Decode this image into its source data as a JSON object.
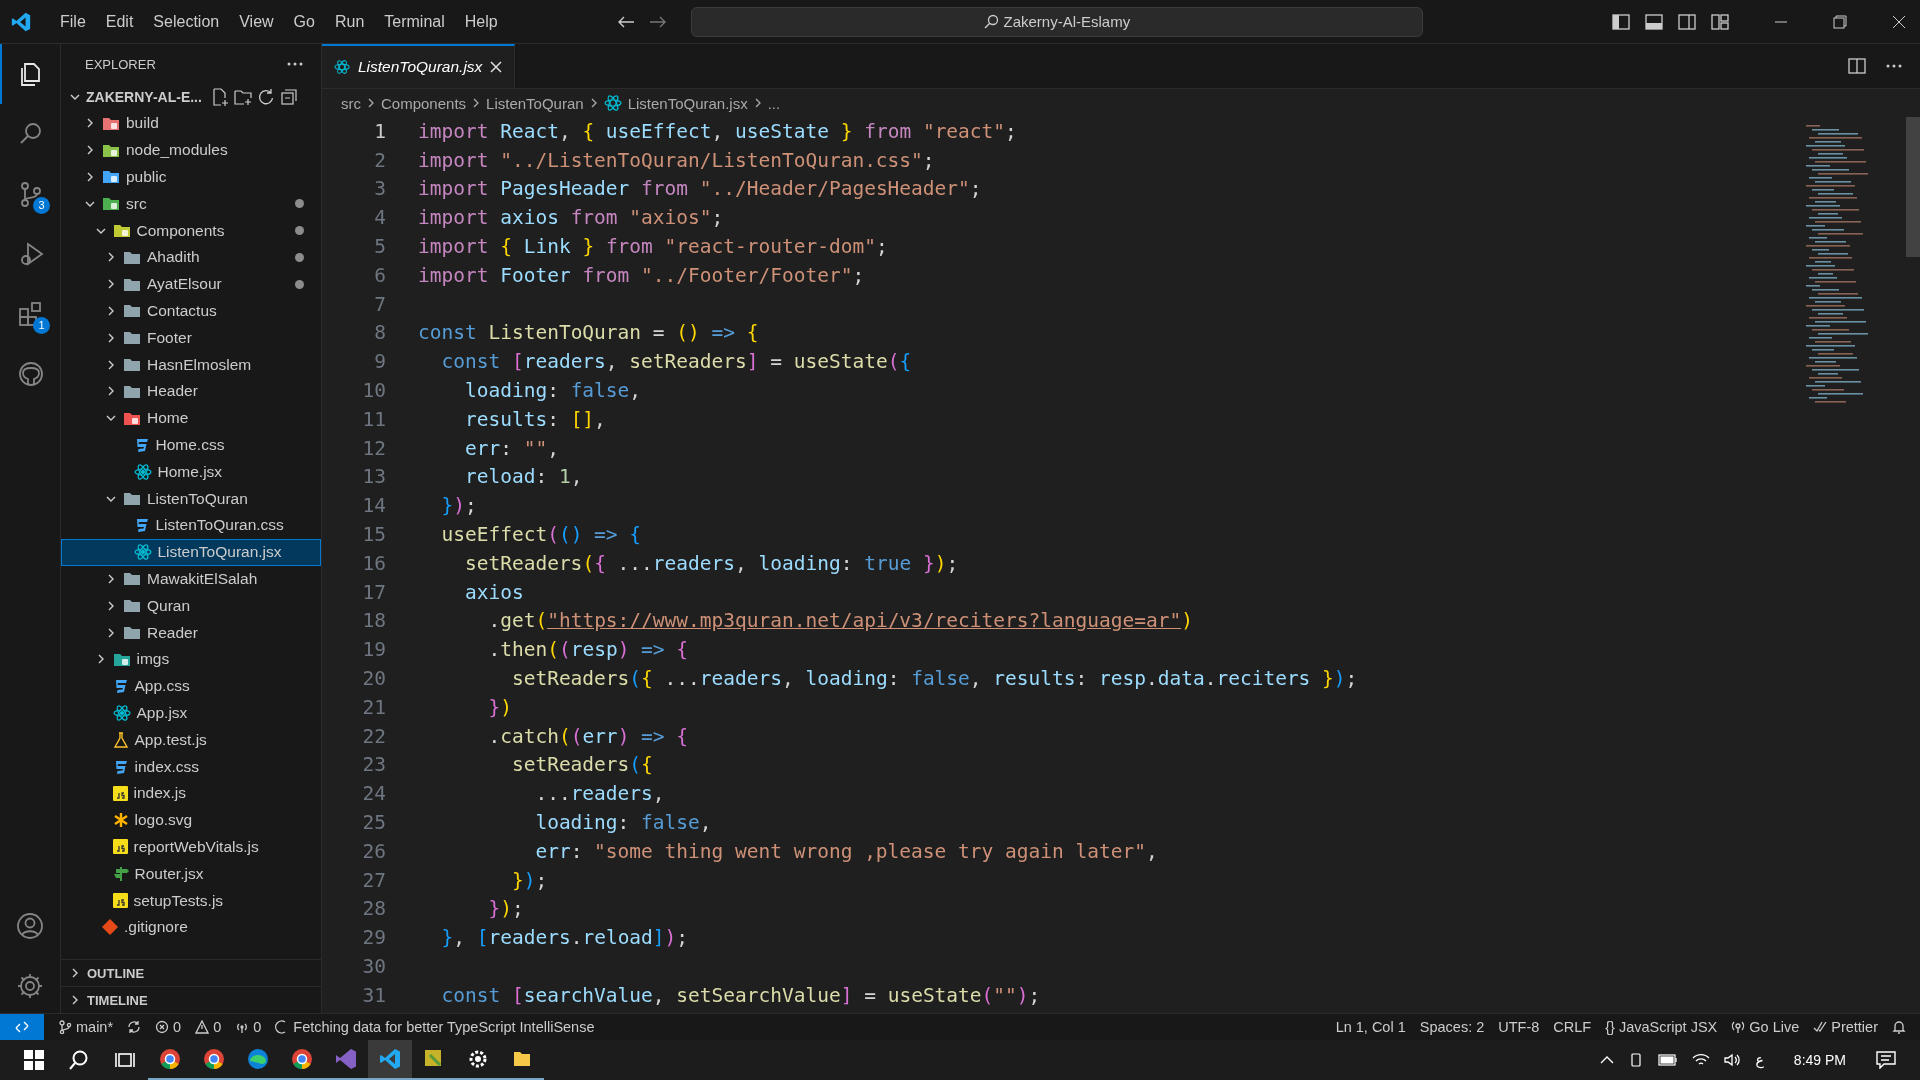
{
  "title_bar": {
    "menu": [
      "File",
      "Edit",
      "Selection",
      "View",
      "Go",
      "Run",
      "Terminal",
      "Help"
    ],
    "search": {
      "value": "Zakerny-Al-Eslamy"
    }
  },
  "activity_bar": {
    "items": [
      {
        "kind": "files",
        "selected": true
      },
      {
        "kind": "search",
        "selected": false
      },
      {
        "kind": "branch",
        "selected": false,
        "badge": "3"
      },
      {
        "kind": "debug",
        "selected": false
      },
      {
        "kind": "extensions",
        "selected": false,
        "badge": "1"
      },
      {
        "kind": "github",
        "selected": false
      }
    ]
  },
  "explorer": {
    "title": "EXPLORER",
    "root": "ZAKERNY-AL-E...",
    "tree": [
      {
        "name": "build",
        "kind": "build",
        "expanded": false,
        "selected": false,
        "modified": false
      },
      {
        "name": "node_modules",
        "kind": "node",
        "expanded": false,
        "selected": false,
        "modified": false
      },
      {
        "name": "public",
        "kind": "public",
        "expanded": false,
        "selected": false,
        "modified": false
      },
      {
        "name": "src",
        "kind": "src",
        "expanded": true,
        "selected": false,
        "modified": true,
        "children": [
          {
            "name": "Components",
            "kind": "components",
            "expanded": true,
            "selected": false,
            "modified": true,
            "children": [
              {
                "name": "Ahadith",
                "kind": "folder",
                "expanded": false,
                "selected": false,
                "modified": true
              },
              {
                "name": "AyatElsour",
                "kind": "folder",
                "expanded": false,
                "selected": false,
                "modified": true
              },
              {
                "name": "Contactus",
                "kind": "folder",
                "expanded": false,
                "selected": false,
                "modified": false
              },
              {
                "name": "Footer",
                "kind": "folder",
                "expanded": false,
                "selected": false,
                "modified": false
              },
              {
                "name": "HasnElmoslem",
                "kind": "folder",
                "expanded": false,
                "selected": false,
                "modified": false
              },
              {
                "name": "Header",
                "kind": "folder",
                "expanded": false,
                "selected": false,
                "modified": false
              },
              {
                "name": "Home",
                "kind": "home",
                "expanded": true,
                "selected": false,
                "modified": false,
                "children": [
                  {
                    "name": "Home.css",
                    "kind": "css",
                    "selected": false,
                    "modified": false
                  },
                  {
                    "name": "Home.jsx",
                    "kind": "react",
                    "selected": false,
                    "modified": false
                  }
                ]
              },
              {
                "name": "ListenToQuran",
                "kind": "folder",
                "expanded": true,
                "selected": false,
                "modified": false,
                "children": [
                  {
                    "name": "ListenToQuran.css",
                    "kind": "css",
                    "selected": false,
                    "modified": false
                  },
                  {
                    "name": "ListenToQuran.jsx",
                    "kind": "react",
                    "selected": true,
                    "modified": false
                  }
                ]
              },
              {
                "name": "MawakitElSalah",
                "kind": "folder",
                "expanded": false,
                "selected": false,
                "modified": false
              },
              {
                "name": "Quran",
                "kind": "folder",
                "expanded": false,
                "selected": false,
                "modified": false
              },
              {
                "name": "Reader",
                "kind": "folder",
                "expanded": false,
                "selected": false,
                "modified": false
              }
            ]
          },
          {
            "name": "imgs",
            "kind": "imgs",
            "expanded": false,
            "selected": false,
            "modified": false
          },
          {
            "name": "App.css",
            "kind": "css",
            "selected": false,
            "modified": false
          },
          {
            "name": "App.jsx",
            "kind": "react",
            "selected": false,
            "modified": false
          },
          {
            "name": "App.test.js",
            "kind": "test",
            "selected": false,
            "modified": false
          },
          {
            "name": "index.css",
            "kind": "css",
            "selected": false,
            "modified": false
          },
          {
            "name": "index.js",
            "kind": "js",
            "selected": false,
            "modified": false
          },
          {
            "name": "logo.svg",
            "kind": "logo",
            "selected": false,
            "modified": false
          },
          {
            "name": "reportWebVitals.js",
            "kind": "js",
            "selected": false,
            "modified": false
          },
          {
            "name": "Router.jsx",
            "kind": "router",
            "selected": false,
            "modified": false
          },
          {
            "name": "setupTests.js",
            "kind": "js",
            "selected": false,
            "modified": false
          }
        ]
      },
      {
        "name": ".gitignore",
        "kind": "git",
        "selected": false,
        "modified": false
      }
    ],
    "sections": [
      "OUTLINE",
      "TIMELINE"
    ]
  },
  "tabs": [
    {
      "label": "ListenToQuran.jsx",
      "selected": true
    }
  ],
  "breadcrumb": [
    "src",
    "Components",
    "ListenToQuran",
    "ListenToQuran.jsx",
    "..."
  ],
  "editor": {
    "lines": [
      {
        "number": "1",
        "tokens": [
          {
            "text": "import ",
            "kind": "ctl"
          },
          {
            "text": "React",
            "kind": "var"
          },
          {
            "text": ", ",
            "kind": "p"
          },
          {
            "text": "{",
            "kind": "b1"
          },
          {
            "text": " useEffect",
            "kind": "var"
          },
          {
            "text": ", ",
            "kind": "p"
          },
          {
            "text": "useState ",
            "kind": "var"
          },
          {
            "text": "}",
            "kind": "b1"
          },
          {
            "text": " from ",
            "kind": "ctl"
          },
          {
            "text": "\"react\"",
            "kind": "str"
          },
          {
            "text": ";",
            "kind": "p"
          }
        ]
      },
      {
        "number": "2",
        "tokens": [
          {
            "text": "import ",
            "kind": "ctl"
          },
          {
            "text": "\"../ListenToQuran/ListenToQuran.css\"",
            "kind": "str"
          },
          {
            "text": ";",
            "kind": "p"
          }
        ]
      },
      {
        "number": "3",
        "tokens": [
          {
            "text": "import ",
            "kind": "ctl"
          },
          {
            "text": "PagesHeader",
            "kind": "var"
          },
          {
            "text": " from ",
            "kind": "ctl"
          },
          {
            "text": "\"../Header/PagesHeader\"",
            "kind": "str"
          },
          {
            "text": ";",
            "kind": "p"
          }
        ]
      },
      {
        "number": "4",
        "tokens": [
          {
            "text": "import ",
            "kind": "ctl"
          },
          {
            "text": "axios",
            "kind": "var"
          },
          {
            "text": " from ",
            "kind": "ctl"
          },
          {
            "text": "\"axios\"",
            "kind": "str"
          },
          {
            "text": ";",
            "kind": "p"
          }
        ]
      },
      {
        "number": "5",
        "tokens": [
          {
            "text": "import ",
            "kind": "ctl"
          },
          {
            "text": "{",
            "kind": "b1"
          },
          {
            "text": " Link ",
            "kind": "var"
          },
          {
            "text": "}",
            "kind": "b1"
          },
          {
            "text": " from ",
            "kind": "ctl"
          },
          {
            "text": "\"react-router-dom\"",
            "kind": "str"
          },
          {
            "text": ";",
            "kind": "p"
          }
        ]
      },
      {
        "number": "6",
        "tokens": [
          {
            "text": "import ",
            "kind": "ctl"
          },
          {
            "text": "Footer",
            "kind": "var"
          },
          {
            "text": " from ",
            "kind": "ctl"
          },
          {
            "text": "\"../Footer/Footer\"",
            "kind": "str"
          },
          {
            "text": ";",
            "kind": "p"
          }
        ]
      },
      {
        "number": "7"
      },
      {
        "number": "8",
        "tokens": [
          {
            "text": "const ",
            "kind": "kw"
          },
          {
            "text": "ListenToQuran",
            "kind": "fn"
          },
          {
            "text": " = ",
            "kind": "p"
          },
          {
            "text": "()",
            "kind": "b1"
          },
          {
            "text": " => ",
            "kind": "kw"
          },
          {
            "text": "{",
            "kind": "b1"
          }
        ]
      },
      {
        "number": "9",
        "tokens": [
          {
            "text": "  const ",
            "kind": "kw"
          },
          {
            "text": "[",
            "kind": "b2"
          },
          {
            "text": "readers",
            "kind": "var"
          },
          {
            "text": ", ",
            "kind": "p"
          },
          {
            "text": "setReaders",
            "kind": "fn"
          },
          {
            "text": "]",
            "kind": "b2"
          },
          {
            "text": " = ",
            "kind": "p"
          },
          {
            "text": "useState",
            "kind": "fn"
          },
          {
            "text": "(",
            "kind": "b2"
          },
          {
            "text": "{",
            "kind": "b3"
          }
        ]
      },
      {
        "number": "10",
        "tokens": [
          {
            "text": "    loading",
            "kind": "var"
          },
          {
            "text": ": ",
            "kind": "p"
          },
          {
            "text": "false",
            "kind": "kw"
          },
          {
            "text": ",",
            "kind": "p"
          }
        ]
      },
      {
        "number": "11",
        "tokens": [
          {
            "text": "    results",
            "kind": "var"
          },
          {
            "text": ": ",
            "kind": "p"
          },
          {
            "text": "[]",
            "kind": "b1"
          },
          {
            "text": ",",
            "kind": "p"
          }
        ]
      },
      {
        "number": "12",
        "tokens": [
          {
            "text": "    err",
            "kind": "var"
          },
          {
            "text": ": ",
            "kind": "p"
          },
          {
            "text": "\"\"",
            "kind": "str"
          },
          {
            "text": ",",
            "kind": "p"
          }
        ]
      },
      {
        "number": "13",
        "tokens": [
          {
            "text": "    reload",
            "kind": "var"
          },
          {
            "text": ": ",
            "kind": "p"
          },
          {
            "text": "1",
            "kind": "num"
          },
          {
            "text": ",",
            "kind": "p"
          }
        ]
      },
      {
        "number": "14",
        "tokens": [
          {
            "text": "  }",
            "kind": "b3"
          },
          {
            "text": ")",
            "kind": "b2"
          },
          {
            "text": ";",
            "kind": "p"
          }
        ]
      },
      {
        "number": "15",
        "tokens": [
          {
            "text": "  useEffect",
            "kind": "fn"
          },
          {
            "text": "(",
            "kind": "b2"
          },
          {
            "text": "()",
            "kind": "b3"
          },
          {
            "text": " => ",
            "kind": "kw"
          },
          {
            "text": "{",
            "kind": "b3"
          }
        ]
      },
      {
        "number": "16",
        "tokens": [
          {
            "text": "    setReaders",
            "kind": "fn"
          },
          {
            "text": "(",
            "kind": "b1"
          },
          {
            "text": "{",
            "kind": "b2"
          },
          {
            "text": " ...",
            "kind": "p"
          },
          {
            "text": "readers",
            "kind": "var"
          },
          {
            "text": ", ",
            "kind": "p"
          },
          {
            "text": "loading",
            "kind": "var"
          },
          {
            "text": ": ",
            "kind": "p"
          },
          {
            "text": "true ",
            "kind": "kw"
          },
          {
            "text": "}",
            "kind": "b2"
          },
          {
            "text": ")",
            "kind": "b1"
          },
          {
            "text": ";",
            "kind": "p"
          }
        ]
      },
      {
        "number": "17",
        "tokens": [
          {
            "text": "    axios",
            "kind": "var"
          }
        ]
      },
      {
        "number": "18",
        "tokens": [
          {
            "text": "      .",
            "kind": "p"
          },
          {
            "text": "get",
            "kind": "fn"
          },
          {
            "text": "(",
            "kind": "b1"
          },
          {
            "text": "\"https://www.mp3quran.net/api/v3/reciters?language=ar\"",
            "kind": "link"
          },
          {
            "text": ")",
            "kind": "b1"
          }
        ]
      },
      {
        "number": "19",
        "tokens": [
          {
            "text": "      .",
            "kind": "p"
          },
          {
            "text": "then",
            "kind": "fn"
          },
          {
            "text": "(",
            "kind": "b1"
          },
          {
            "text": "(",
            "kind": "b2"
          },
          {
            "text": "resp",
            "kind": "var"
          },
          {
            "text": ")",
            "kind": "b2"
          },
          {
            "text": " => ",
            "kind": "kw"
          },
          {
            "text": "{",
            "kind": "b2"
          }
        ]
      },
      {
        "number": "20",
        "tokens": [
          {
            "text": "        setReaders",
            "kind": "fn"
          },
          {
            "text": "(",
            "kind": "b3"
          },
          {
            "text": "{",
            "kind": "b1"
          },
          {
            "text": " ...",
            "kind": "p"
          },
          {
            "text": "readers",
            "kind": "var"
          },
          {
            "text": ", ",
            "kind": "p"
          },
          {
            "text": "loading",
            "kind": "var"
          },
          {
            "text": ": ",
            "kind": "p"
          },
          {
            "text": "false",
            "kind": "kw"
          },
          {
            "text": ", ",
            "kind": "p"
          },
          {
            "text": "results",
            "kind": "var"
          },
          {
            "text": ": ",
            "kind": "p"
          },
          {
            "text": "resp",
            "kind": "var"
          },
          {
            "text": ".",
            "kind": "p"
          },
          {
            "text": "data",
            "kind": "var"
          },
          {
            "text": ".",
            "kind": "p"
          },
          {
            "text": "reciters ",
            "kind": "var"
          },
          {
            "text": "}",
            "kind": "b1"
          },
          {
            "text": ")",
            "kind": "b3"
          },
          {
            "text": ";",
            "kind": "p"
          }
        ]
      },
      {
        "number": "21",
        "tokens": [
          {
            "text": "      }",
            "kind": "b2"
          },
          {
            "text": ")",
            "kind": "b1"
          }
        ]
      },
      {
        "number": "22",
        "tokens": [
          {
            "text": "      .",
            "kind": "p"
          },
          {
            "text": "catch",
            "kind": "fn"
          },
          {
            "text": "(",
            "kind": "b1"
          },
          {
            "text": "(",
            "kind": "b2"
          },
          {
            "text": "err",
            "kind": "var"
          },
          {
            "text": ")",
            "kind": "b2"
          },
          {
            "text": " => ",
            "kind": "kw"
          },
          {
            "text": "{",
            "kind": "b2"
          }
        ]
      },
      {
        "number": "23",
        "tokens": [
          {
            "text": "        setReaders",
            "kind": "fn"
          },
          {
            "text": "(",
            "kind": "b3"
          },
          {
            "text": "{",
            "kind": "b1"
          }
        ]
      },
      {
        "number": "24",
        "tokens": [
          {
            "text": "          ...",
            "kind": "p"
          },
          {
            "text": "readers",
            "kind": "var"
          },
          {
            "text": ",",
            "kind": "p"
          }
        ]
      },
      {
        "number": "25",
        "tokens": [
          {
            "text": "          loading",
            "kind": "var"
          },
          {
            "text": ": ",
            "kind": "p"
          },
          {
            "text": "false",
            "kind": "kw"
          },
          {
            "text": ",",
            "kind": "p"
          }
        ]
      },
      {
        "number": "26",
        "tokens": [
          {
            "text": "          err",
            "kind": "var"
          },
          {
            "text": ": ",
            "kind": "p"
          },
          {
            "text": "\"some thing went wrong ,please try again later\"",
            "kind": "str"
          },
          {
            "text": ",",
            "kind": "p"
          }
        ]
      },
      {
        "number": "27",
        "tokens": [
          {
            "text": "        }",
            "kind": "b1"
          },
          {
            "text": ")",
            "kind": "b3"
          },
          {
            "text": ";",
            "kind": "p"
          }
        ]
      },
      {
        "number": "28",
        "tokens": [
          {
            "text": "      }",
            "kind": "b2"
          },
          {
            "text": ")",
            "kind": "b1"
          },
          {
            "text": ";",
            "kind": "p"
          }
        ]
      },
      {
        "number": "29",
        "tokens": [
          {
            "text": "  }",
            "kind": "b3"
          },
          {
            "text": ", ",
            "kind": "p"
          },
          {
            "text": "[",
            "kind": "b3"
          },
          {
            "text": "readers",
            "kind": "var"
          },
          {
            "text": ".",
            "kind": "p"
          },
          {
            "text": "reload",
            "kind": "var"
          },
          {
            "text": "]",
            "kind": "b3"
          },
          {
            "text": ")",
            "kind": "b2"
          },
          {
            "text": ";",
            "kind": "p"
          }
        ]
      },
      {
        "number": "30"
      },
      {
        "number": "31",
        "tokens": [
          {
            "text": "  const ",
            "kind": "kw"
          },
          {
            "text": "[",
            "kind": "b2"
          },
          {
            "text": "searchValue",
            "kind": "var"
          },
          {
            "text": ", ",
            "kind": "p"
          },
          {
            "text": "setSearchValue",
            "kind": "fn"
          },
          {
            "text": "]",
            "kind": "b2"
          },
          {
            "text": " = ",
            "kind": "p"
          },
          {
            "text": "useState",
            "kind": "fn"
          },
          {
            "text": "(",
            "kind": "b2"
          },
          {
            "text": "\"\"",
            "kind": "str"
          },
          {
            "text": ")",
            "kind": "b2"
          },
          {
            "text": ";",
            "kind": "p"
          }
        ]
      }
    ]
  },
  "status_bar": {
    "left": [
      {
        "kind": "branch",
        "text": "main*"
      },
      {
        "kind": "sync"
      },
      {
        "kind": "error",
        "text": "0"
      },
      {
        "kind": "warning",
        "text": "0"
      },
      {
        "kind": "ports",
        "text": "0"
      },
      {
        "kind": "spinner",
        "text": "Fetching data for better TypeScript IntelliSense"
      }
    ],
    "right": [
      {
        "kind": "none",
        "text": "Ln 1, Col 1"
      },
      {
        "kind": "none",
        "text": "Spaces: 2"
      },
      {
        "kind": "none",
        "text": "UTF-8"
      },
      {
        "kind": "none",
        "text": "CRLF"
      },
      {
        "kind": "none",
        "text": "{} JavaScript JSX"
      },
      {
        "kind": "radio",
        "text": "Go Live"
      },
      {
        "kind": "check",
        "text": "Prettier"
      },
      {
        "kind": "bell"
      }
    ]
  },
  "taskbar": {
    "apps": [
      {
        "kind": "chrome",
        "selected": false
      },
      {
        "kind": "chrome",
        "selected": false
      },
      {
        "kind": "edge",
        "selected": false
      },
      {
        "kind": "chrome",
        "selected": false
      },
      {
        "kind": "vs",
        "selected": false
      },
      {
        "kind": "vscode",
        "selected": true
      },
      {
        "kind": "tool",
        "selected": false
      },
      {
        "kind": "gear",
        "selected": false
      },
      {
        "kind": "files",
        "selected": false
      }
    ],
    "language": "ع",
    "time": "8:49 PM"
  }
}
